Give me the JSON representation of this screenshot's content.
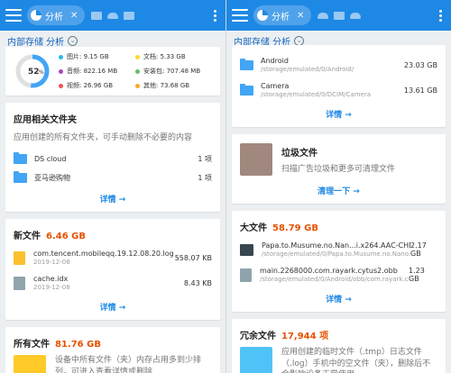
{
  "tab": {
    "label": "分析",
    "close": "✕"
  },
  "path": {
    "label": "内部存储 分析"
  },
  "left": {
    "storage": {
      "percent": "52",
      "percent_sign": "%",
      "legend": [
        {
          "label": "图片: 9.15 GB",
          "color": "#29b6f6"
        },
        {
          "label": "文档: 5.33 GB",
          "color": "#fdd835"
        },
        {
          "label": "音频: 822.16 MB",
          "color": "#ab47bc"
        },
        {
          "label": "安装包: 707.48 MB",
          "color": "#66bb6a"
        },
        {
          "label": "视频: 26.96 GB",
          "color": "#ef5350"
        },
        {
          "label": "其他: 73.68 GB",
          "color": "#ffa726"
        }
      ]
    },
    "app_folders": {
      "title": "应用相关文件夹",
      "subtitle": "应用创建的所有文件夹，可手动删除不必要的内容",
      "items": [
        {
          "name": "DS cloud",
          "count": "1 项"
        },
        {
          "name": "亚马逊购物",
          "count": "1 项"
        }
      ],
      "detail": "详情 →"
    },
    "new_files": {
      "title": "新文件",
      "size": "6.46 GB",
      "items": [
        {
          "name": "com.tencent.mobileqq.19.12.08.20.log",
          "date": "2019-12-08",
          "size": "558.07 KB"
        },
        {
          "name": "cache.idx",
          "date": "2019-12-08",
          "size": "8.43 KB"
        }
      ],
      "detail": "详情 →"
    },
    "all_files": {
      "title": "所有文件",
      "size": "81.76 GB",
      "desc": "设备中所有文件（夹）内存占用多到少排列，可进入查看详情或删除"
    }
  },
  "right": {
    "folders": {
      "items": [
        {
          "name": "Android",
          "path": "/storage/emulated/0/Android/",
          "size": "23.03 GB"
        },
        {
          "name": "Camera",
          "path": "/storage/emulated/0/DCIM/Camera",
          "size": "13.61 GB"
        }
      ],
      "detail": "详情 →"
    },
    "junk": {
      "title": "垃圾文件",
      "desc": "扫描广告垃圾和更多可清理文件",
      "action": "清理一下 →"
    },
    "large_files": {
      "title": "大文件",
      "size": "58.79 GB",
      "items": [
        {
          "name": "Papa.to.Musume.no.Nan...i.x264.AAC-CHDTV.mkv",
          "path": "/storage/emulated/0/Papa.to.Musume.no.Nano...",
          "size": "2.17 GB"
        },
        {
          "name": "main.2268000.com.rayark.cytus2.obb",
          "path": "/storage/emulated/0/Android/obb/com.rayark.co...",
          "size": "1.23 GB"
        }
      ],
      "detail": "详情 →"
    },
    "redundant": {
      "title": "冗余文件",
      "size": "17,944 项",
      "desc": "应用创建的临时文件（.tmp）日志文件（.log）手机中的空文件（夹），删除后不会影响设备正常使用"
    }
  }
}
